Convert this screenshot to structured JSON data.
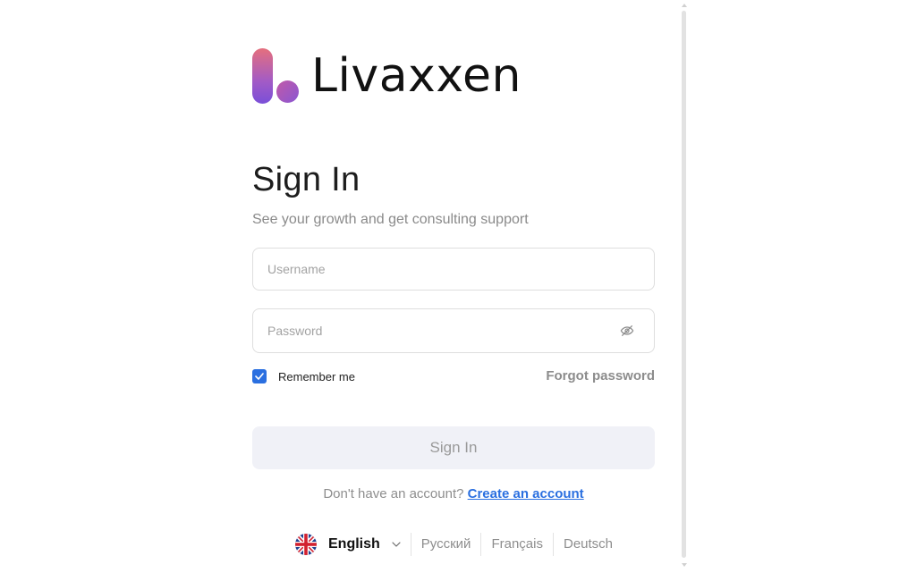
{
  "brand": {
    "name": "Livaxxen",
    "logo_icon": "livaxxen-logo-icon"
  },
  "form": {
    "title": "Sign In",
    "subtitle": "See your growth and get consulting support",
    "username_placeholder": "Username",
    "password_placeholder": "Password",
    "remember_label": "Remember me",
    "remember_checked": true,
    "forgot_label": "Forgot password",
    "submit_label": "Sign In"
  },
  "signup": {
    "prompt": "Don't have an account?",
    "link_label": "Create an account"
  },
  "language": {
    "current": "English",
    "current_flag_icon": "uk-flag-icon",
    "options": [
      "Русский",
      "Français",
      "Deutsch"
    ]
  },
  "colors": {
    "accent": "#2a6fe0",
    "logo_gradient_start": "#e56f7d",
    "logo_gradient_end": "#7a4fd8",
    "button_bg": "#f0f1f7"
  }
}
